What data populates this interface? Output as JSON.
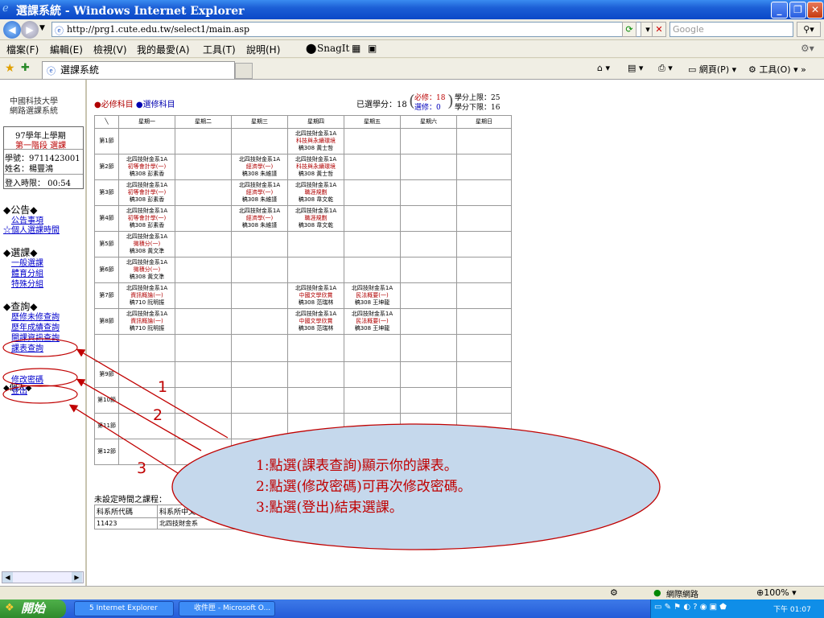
{
  "window": {
    "title": "選課系統 - Windows Internet Explorer"
  },
  "address": {
    "url": "http://prg1.cute.edu.tw/select1/main.asp",
    "search_placeholder": "Google"
  },
  "menu": [
    "檔案(F)",
    "編輯(E)",
    "檢視(V)",
    "我的最愛(A)",
    "工具(T)",
    "說明(H)",
    "SnagIt"
  ],
  "tab": {
    "label": "選課系統"
  },
  "tab_tools": {
    "page": "網頁(P)",
    "tools": "工具(O)"
  },
  "left": {
    "school": "中國科技大學",
    "system": "網路選課系統",
    "term": "97學年上學期",
    "stage": "第一階段 選課",
    "student_id": "學號：9711423001",
    "name": "姓名：楊豐鴻",
    "login": "登入時限： 00:54",
    "sec_notice": "◆公告◆",
    "notice": "公告事項",
    "personal_time": "☆個人選課時間",
    "sec_select": "◆選課◆",
    "general": "一般選課",
    "pe": "體育分組",
    "special": "特殊分組",
    "sec_query": "◆查詢◆",
    "history": "歷修未修查詢",
    "grades": "歷年成績查詢",
    "courseinfo": "開課資訊查詢",
    "timetable": "課表查詢",
    "sec_personal": "◆個人◆",
    "change_pw": "修改密碼",
    "logout": "登出"
  },
  "legend": {
    "required": "●必修科目",
    "elective": "●選修科目"
  },
  "credits": {
    "label": "已選學分：",
    "total": "18",
    "req": "必修：18",
    "ele": "選修：0",
    "max": "學分上限：25",
    "min": "學分下限：16"
  },
  "schedule": {
    "corner": "╲",
    "days": [
      "星期一",
      "星期二",
      "星期三",
      "星期四",
      "星期五",
      "星期六",
      "星期日"
    ],
    "periods": [
      "第1節",
      "第2節",
      "第3節",
      "第4節",
      "第5節",
      "第6節",
      "第7節",
      "第8節",
      "",
      "第9節",
      "第10節",
      "第11節",
      "第12節"
    ],
    "cells": {
      "0-3": "北四技財金系1A|科技與永續環境|稿308 黃士哲",
      "1-0": "北四技財金系1A|初等會計學(一)|稿308 彭素香",
      "1-2": "北四技財金系1A|經濟學(一)|稿308 朱維謹",
      "1-3": "北四技財金系1A|科技與永續環境|稿308 黃士哲",
      "2-0": "北四技財金系1A|初等會計學(一)|稿308 彭素香",
      "2-2": "北四技財金系1A|經濟學(一)|稿308 朱維謹",
      "2-3": "北四技財金系1A|職涯規劃|稿308 韋文乾",
      "3-0": "北四技財金系1A|初等會計學(一)|稿308 彭素香",
      "3-2": "北四技財金系1A|經濟學(一)|稿308 朱維謹",
      "3-3": "北四技財金系1A|職涯規劃|稿308 韋文乾",
      "4-0": "北四技財金系1A|微積分(一)|稿308 黃文準",
      "5-0": "北四技財金系1A|微積分(一)|稿308 黃文準",
      "6-0": "北四技財金系1A|資訊概論(一)|稿710 阮明振",
      "6-3": "北四技財金系1A|中國文學欣賞|稿308 范瑞林",
      "6-4": "北四技財金系1A|民法概要(一)|稿308 王坤龍",
      "7-0": "北四技財金系1A|資訊概論(一)|稿710 阮明振",
      "7-3": "北四技財金系1A|中國文學欣賞|稿308 范瑞林",
      "7-4": "北四技財金系1A|民法概要(一)|稿308 王坤龍"
    }
  },
  "unscheduled": {
    "title": "未設定時間之課程：",
    "col1": "科系所代碼",
    "col2": "科系所中文",
    "row_code": "11423",
    "row_name": "北四技財金系"
  },
  "status": {
    "zone": "網際網路",
    "zoom": "100%"
  },
  "taskbar": {
    "start": "開始",
    "task1": "5 Internet Explorer",
    "task2": "收件匣 - Microsoft O...",
    "clock": "下午 01:07"
  },
  "annotation": {
    "line1": "1:點選(課表查詢)顯示你的課表。",
    "line2": "2:點選(修改密碼)可再次修改密碼。",
    "line3": "3:點選(登出)結束選課。",
    "n1": "1",
    "n2": "2",
    "n3": "3"
  }
}
